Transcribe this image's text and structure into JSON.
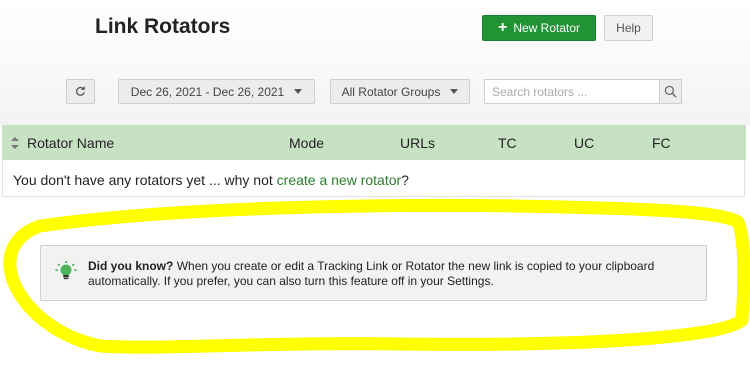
{
  "header": {
    "title": "Link Rotators",
    "new_button_label": "New Rotator",
    "help_button_label": "Help"
  },
  "toolbar": {
    "refresh_icon": "refresh-icon",
    "date_range": "Dec 26, 2021 - Dec 26, 2021",
    "groups_filter": "All Rotator Groups",
    "search_placeholder": "Search rotators ..."
  },
  "table": {
    "columns": [
      "Rotator Name",
      "Mode",
      "URLs",
      "TC",
      "UC",
      "FC"
    ],
    "empty_text": "You don't have any rotators yet ... why not",
    "empty_link": "create a new rotator",
    "empty_suffix": "?"
  },
  "tip": {
    "heading": "Did you know?",
    "body": "When you create or edit a Tracking Link or Rotator the new link is copied to your clipboard automatically. If you prefer, you can also turn this feature off in your Settings."
  },
  "colors": {
    "primary": "#219334",
    "table_header": "#c7e2c3",
    "link": "#2a7d2a",
    "highlight_marker": "#ffff00"
  }
}
